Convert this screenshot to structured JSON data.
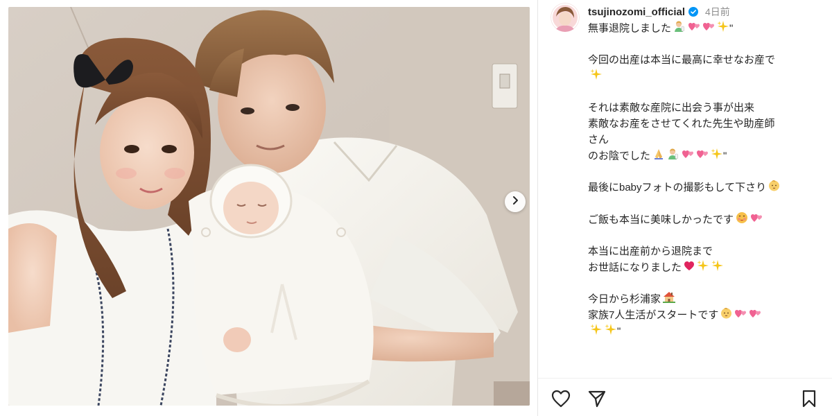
{
  "post": {
    "username": "tsujinozomi_official",
    "time_ago": "4日前",
    "caption_lines": [
      {
        "text": "無事退院しました",
        "emoji": [
          "baby-bottle-woman",
          "hearts",
          "hearts",
          "sparkles"
        ],
        "suffix": "\""
      },
      {
        "text": "",
        "emoji": [],
        "suffix": ""
      },
      {
        "text": "今回の出産は本当に最高に幸せなお産で",
        "emoji": [],
        "suffix": ""
      },
      {
        "text": "",
        "emoji": [
          "sparkles"
        ],
        "suffix": ""
      },
      {
        "text": "",
        "emoji": [],
        "suffix": ""
      },
      {
        "text": "それは素敵な産院に出会う事が出来",
        "emoji": [],
        "suffix": ""
      },
      {
        "text": "素敵なお産をさせてくれた先生や助産師",
        "emoji": [],
        "suffix": ""
      },
      {
        "text": "さん",
        "emoji": [],
        "suffix": ""
      },
      {
        "text": "のお陰でした",
        "emoji": [
          "folded-hands",
          "baby-bottle-woman",
          "hearts",
          "hearts",
          "sparkles"
        ],
        "suffix": "\""
      },
      {
        "text": "",
        "emoji": [],
        "suffix": ""
      },
      {
        "text": "最後にbabyフォトの撮影もして下さり",
        "emoji": [
          "baby-face"
        ],
        "suffix": ""
      },
      {
        "text": "",
        "emoji": [],
        "suffix": ""
      },
      {
        "text": "ご飯も本当に美味しかったです",
        "emoji": [
          "yum-face",
          "hearts"
        ],
        "suffix": ""
      },
      {
        "text": "",
        "emoji": [],
        "suffix": ""
      },
      {
        "text": "本当に出産前から退院まで",
        "emoji": [],
        "suffix": ""
      },
      {
        "text": "お世話になりました",
        "emoji": [
          "red-heart",
          "sparkles",
          "sparkles"
        ],
        "suffix": ""
      },
      {
        "text": "",
        "emoji": [],
        "suffix": ""
      },
      {
        "text": "今日から杉浦家",
        "emoji": [
          "house"
        ],
        "suffix": ""
      },
      {
        "text": "家族7人生活がスタートです",
        "emoji": [
          "baby-face",
          "hearts",
          "hearts"
        ],
        "suffix": ""
      },
      {
        "text": "",
        "emoji": [
          "sparkles",
          "sparkles"
        ],
        "suffix": "\""
      }
    ]
  },
  "colors": {
    "text": "#262626",
    "muted": "#8e8e8e",
    "verified": "#0095f6",
    "heart_pink": "#f06292",
    "heart_red": "#e0245e",
    "sparkle": "#f5c518"
  },
  "actions": {
    "like_icon": "heart-outline-icon",
    "share_icon": "paper-plane-icon",
    "save_icon": "bookmark-icon"
  }
}
